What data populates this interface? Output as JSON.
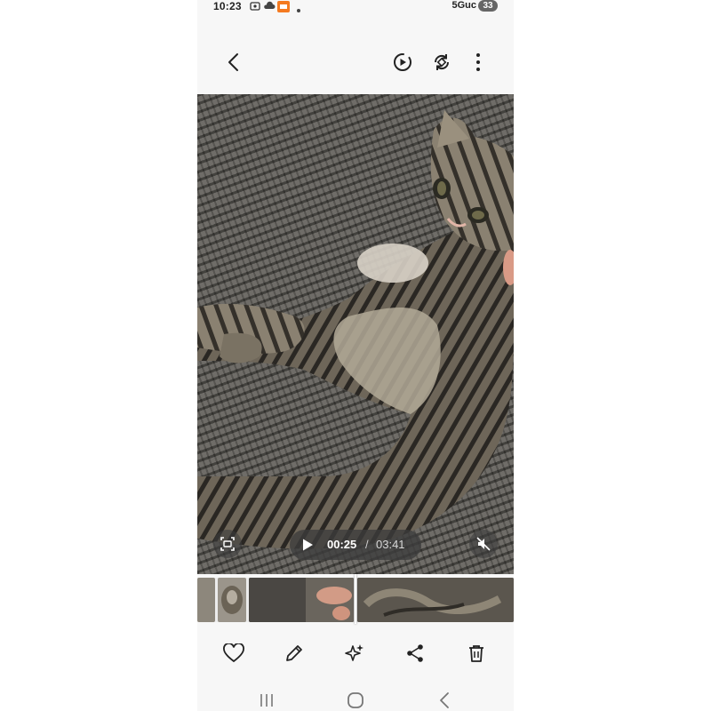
{
  "statusbar": {
    "time": "10:23",
    "network": "5Guc",
    "battery": "33",
    "icons": [
      "screenshot-icon",
      "cloud-icon",
      "app-notification-icon",
      "dot-icon",
      "signal-icon"
    ]
  },
  "topbar": {
    "back_icon": "back-arrow-icon",
    "actions": [
      "motion-play-icon",
      "rotate-icon",
      "more-options-icon"
    ]
  },
  "video": {
    "current_time": "00:25",
    "separator": "/",
    "duration": "03:41",
    "play_icon": "play-icon",
    "capture_icon": "capture-frame-icon",
    "mute_icon": "mute-icon"
  },
  "bottombar": {
    "actions": [
      "heart-icon",
      "edit-pencil-icon",
      "sparkle-effects-icon",
      "share-icon",
      "delete-trash-icon"
    ]
  },
  "navbar": {
    "buttons": [
      "recent-apps-icon",
      "home-icon",
      "back-icon"
    ]
  },
  "colors": {
    "background": "#f7f7f7",
    "player_pill": "#3c3c3c",
    "icon": "#222222"
  }
}
